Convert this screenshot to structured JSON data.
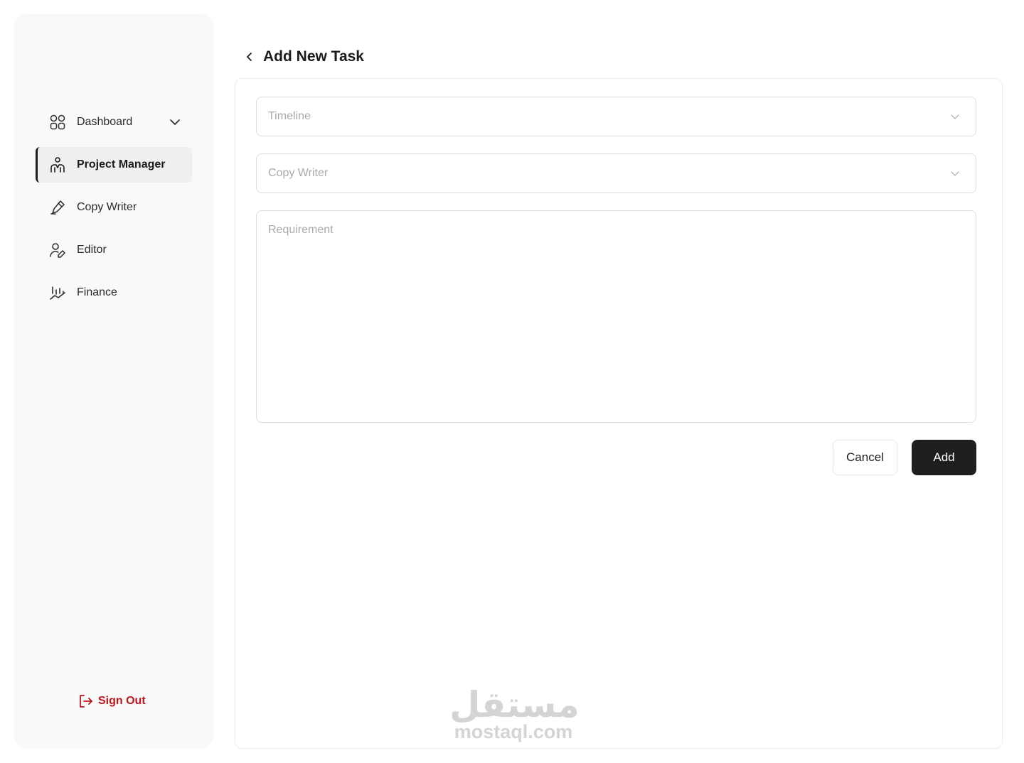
{
  "sidebar": {
    "items": [
      {
        "label": "Dashboard",
        "icon": "grid-icon",
        "has_chevron": true
      },
      {
        "label": "Project Manager",
        "icon": "presenter-icon",
        "active": true
      },
      {
        "label": "Copy Writer",
        "icon": "pen-icon"
      },
      {
        "label": "Editor",
        "icon": "user-edit-icon"
      },
      {
        "label": "Finance",
        "icon": "chart-trend-icon"
      }
    ],
    "sign_out": {
      "label": "Sign Out",
      "icon": "logout-icon",
      "color": "#c0151b"
    }
  },
  "header": {
    "title": "Add New Task",
    "back_icon": "chevron-left-icon"
  },
  "form": {
    "timeline": {
      "placeholder": "Timeline",
      "icon": "chevron-down-icon"
    },
    "copy_writer": {
      "placeholder": "Copy Writer",
      "icon": "chevron-down-icon"
    },
    "requirement": {
      "placeholder": "Requirement"
    },
    "cancel_label": "Cancel",
    "add_label": "Add"
  },
  "watermark": {
    "arabic": "مستقل",
    "latin": "mostaql.com"
  },
  "colors": {
    "accent": "#1f1f1f",
    "danger": "#c0151b",
    "sidebar_bg": "#f9f9f9"
  }
}
